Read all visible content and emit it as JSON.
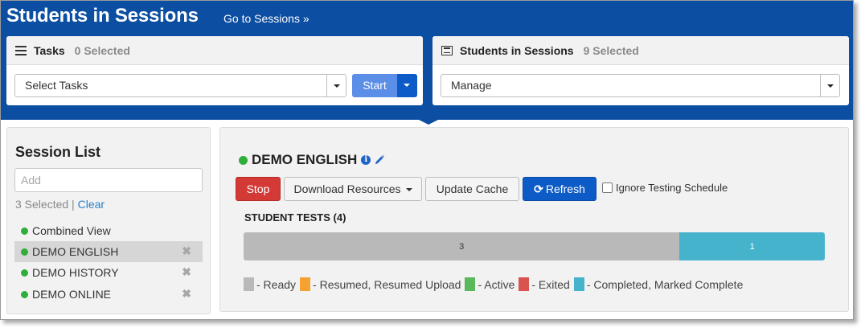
{
  "header": {
    "title": "Students in Sessions",
    "goto_link": "Go to Sessions »"
  },
  "tasks_card": {
    "title": "Tasks",
    "count": "0 Selected",
    "select_value": "Select Tasks",
    "start_label": "Start"
  },
  "sessions_card": {
    "title": "Students in Sessions",
    "count": "9 Selected",
    "select_value": "Manage"
  },
  "sidebar": {
    "title": "Session List",
    "input_placeholder": "Add",
    "selected_text": "3 Selected",
    "separator": " | ",
    "clear_label": "Clear",
    "items": [
      {
        "label": "Combined View",
        "active": false,
        "removable": false
      },
      {
        "label": "DEMO ENGLISH",
        "active": true,
        "removable": true
      },
      {
        "label": "DEMO HISTORY",
        "active": false,
        "removable": true
      },
      {
        "label": "DEMO ONLINE",
        "active": false,
        "removable": true
      }
    ],
    "remove_glyph": "✖"
  },
  "session": {
    "title": "DEMO ENGLISH",
    "status_color": "#2fae3a",
    "buttons": {
      "stop": "Stop",
      "download": "Download Resources",
      "update_cache": "Update Cache",
      "refresh": "Refresh"
    },
    "ignore_schedule_label": "Ignore Testing Schedule",
    "ignore_schedule_checked": false,
    "student_tests_label": "STUDENT TESTS (4)",
    "progress": [
      {
        "status": "Ready",
        "count": 3,
        "label": "3",
        "color": "#b9b9b9"
      },
      {
        "status": "Completed",
        "count": 1,
        "label": "1",
        "color": "#46b3cd"
      }
    ],
    "legend": [
      {
        "label": "- Ready",
        "color": "#b9b9b9"
      },
      {
        "label": "- Resumed, Resumed Upload",
        "color": "#f5a233"
      },
      {
        "label": "- Active",
        "color": "#5cb85c"
      },
      {
        "label": "- Exited",
        "color": "#d9534f"
      },
      {
        "label": "- Completed, Marked Complete",
        "color": "#46b3cd"
      }
    ]
  }
}
